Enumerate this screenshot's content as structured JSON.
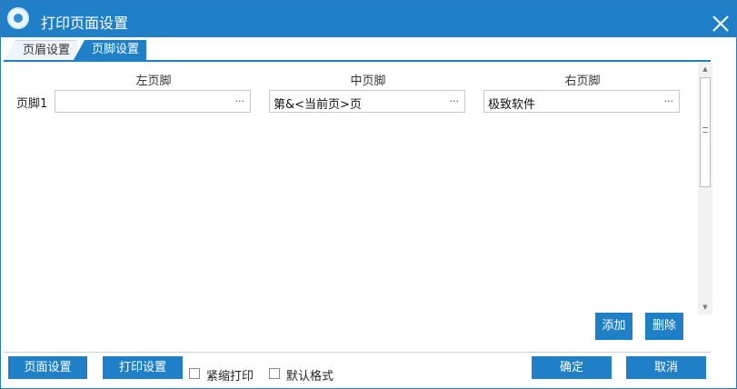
{
  "window": {
    "title": "打印页面设置",
    "logo_icon": "app-logo-icon",
    "close_icon": "close-icon"
  },
  "tabs": [
    {
      "label": "页眉设置",
      "active": false
    },
    {
      "label": "页脚设置",
      "active": true
    }
  ],
  "footer_table": {
    "columns": [
      "左页脚",
      "中页脚",
      "右页脚"
    ],
    "rows": [
      {
        "label": "页脚1",
        "left": "",
        "center": "第&<当前页>页",
        "right": "极致软件"
      }
    ],
    "browse_label": "..."
  },
  "panel_buttons": {
    "add": "添加",
    "delete": "删除"
  },
  "bottom_bar": {
    "page_setup": "页面设置",
    "print_setup": "打印设置",
    "compact_print": {
      "label": "紧缩打印",
      "checked": false
    },
    "default_format": {
      "label": "默认格式",
      "checked": false
    },
    "ok": "确定",
    "cancel": "取消"
  },
  "colors": {
    "accent": "#1f7fc7"
  }
}
